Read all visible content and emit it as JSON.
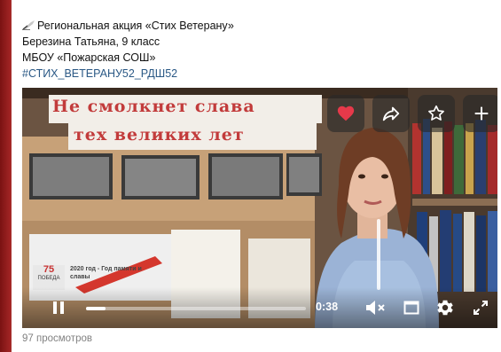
{
  "post": {
    "line1": "Региональная акция «Стих Ветерану»",
    "line2": "Березина Татьяна, 9 класс",
    "line3": "МБОУ «Пожарская СОШ»",
    "hashtag": "#СТИХ_ВЕТЕРАНУ52_РДШ52"
  },
  "banner": {
    "line1": "Не смолкнет слава",
    "line2": "тех великих лет"
  },
  "poster": {
    "logo": "75",
    "logo_sub": "ПОБЕДА",
    "text": "2020 год - Год памяти и славы"
  },
  "player": {
    "time": "0:38",
    "progress": 0.09,
    "icons": [
      "like-icon",
      "share-icon",
      "bookmark-icon",
      "add-icon",
      "pause-icon",
      "mute-icon",
      "fullscreen-window-icon",
      "settings-icon",
      "expand-icon"
    ],
    "like_color": "#e6394a"
  },
  "footer": {
    "views": "97 просмотров"
  }
}
